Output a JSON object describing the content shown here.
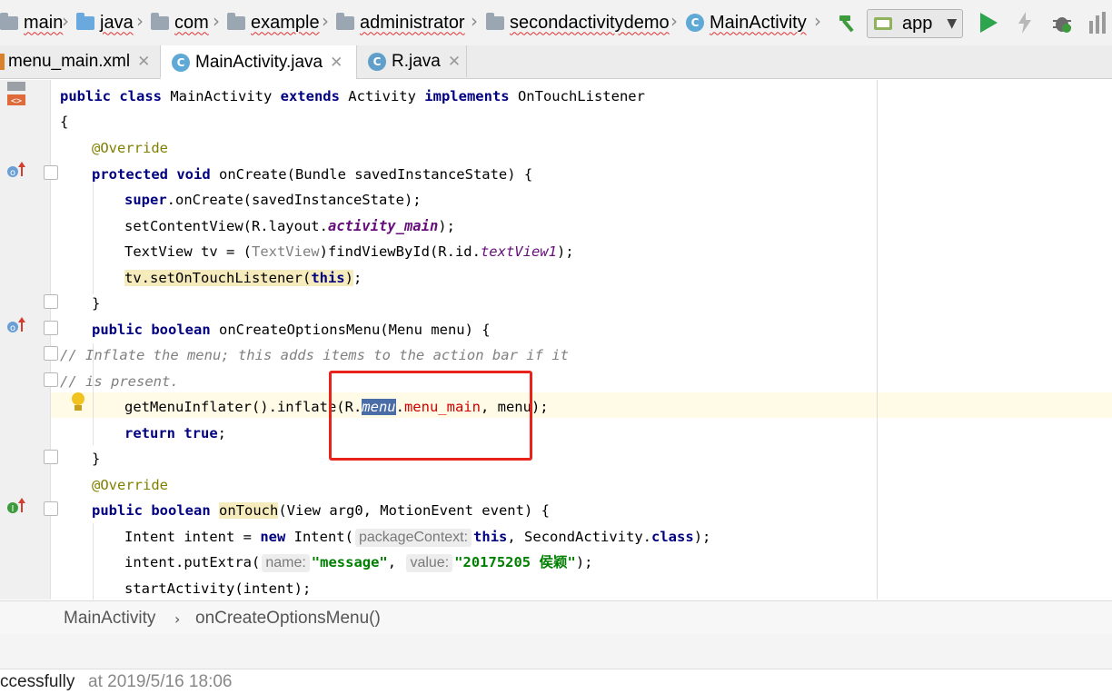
{
  "breadcrumbs": [
    "main",
    "java",
    "com",
    "example",
    "administrator",
    "secondactivitydemo",
    "MainActivity"
  ],
  "toolbar": {
    "run_config": "app"
  },
  "tabs": [
    {
      "label": "menu_main.xml",
      "icon": "xml-file-icon",
      "active": false
    },
    {
      "label": "MainActivity.java",
      "icon": "class-icon",
      "icon_letter": "C",
      "active": true
    },
    {
      "label": "R.java",
      "icon": "class-icon",
      "icon_letter": "C",
      "active": false
    }
  ],
  "code": {
    "l1": {
      "kw1": "public class",
      "t1": " MainActivity ",
      "kw2": "extends",
      "t2": " Activity ",
      "kw3": "implements",
      "t3": " OnTouchListener"
    },
    "l2": "{",
    "l3": "@Override",
    "l4": {
      "kw": "protected void",
      "t": " onCreate(Bundle savedInstanceState) {"
    },
    "l5": {
      "kw": "super",
      "t": ".onCreate(savedInstanceState);"
    },
    "l6": {
      "t1": "setContentView(R.layout.",
      "f": "activity_main",
      "t2": ");"
    },
    "l7": {
      "t1": "TextView tv = (",
      "cast": "TextView",
      "t2": ")findViewById(R.id.",
      "f": "textView1",
      "t3": ");"
    },
    "l8": {
      "t1": "tv.setOnTouchListener(",
      "kw": "this",
      "t2": ")",
      "t3": ";"
    },
    "l9": "}",
    "l10": {
      "kw": "public boolean",
      "t": " onCreateOptionsMenu(Menu menu) {"
    },
    "l11": "// Inflate the menu; this adds items to the action bar if it",
    "l12": "// is present.",
    "l13": {
      "t1": "getMenuInflater().inflate(R.",
      "sel": "menu",
      "dot": ".",
      "err": "menu_main",
      "t2": ", menu);"
    },
    "l14": {
      "kw1": "return",
      "sp": " ",
      "kw2": "true",
      "t": ";"
    },
    "l15": "}",
    "l16": "@Override",
    "l17": {
      "kw": "public boolean",
      "sp": " ",
      "m": "onTouch",
      "t": "(View arg0, MotionEvent event) {"
    },
    "l18": {
      "t1": "Intent intent = ",
      "kw1": "new",
      "t2": " Intent(",
      "hint": "packageContext:",
      "kw2": "this",
      "t3": ", SecondActivity.",
      "kw3": "class",
      "t4": ");"
    },
    "l19": {
      "t1": "intent.putExtra(",
      "hint1": "name:",
      "s1": "\"message\"",
      "t2": ", ",
      "hint2": "value:",
      "s2": "\"20175205 侯颖\"",
      "t3": ");"
    },
    "l20": "startActivity(intent);"
  },
  "editor_breadcrumb": {
    "cls": "MainActivity",
    "method": "onCreateOptionsMenu()"
  },
  "status": {
    "message": "ccessfully",
    "time": "at 2019/5/16 18:06"
  },
  "colors": {
    "keyword": "#000080",
    "annotation": "#808000",
    "string": "#008000",
    "error": "#d00000",
    "highlight_box": "#e8231b"
  }
}
